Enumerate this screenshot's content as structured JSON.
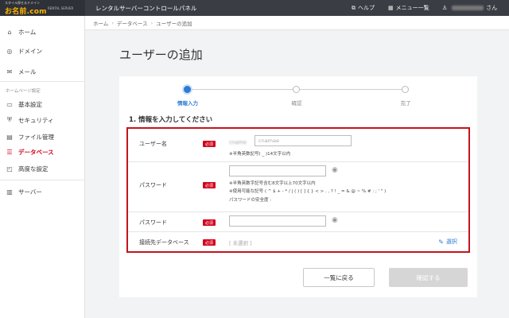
{
  "header": {
    "logo_tagline": "スタイル探せるドメイン",
    "logo_text": "お名前.com",
    "logo_sub": "RENTAL SERVER",
    "panel_title": "レンタルサーバーコントロールパネル",
    "help_label": "ヘルプ",
    "menu_label": "メニュー一覧",
    "user_suffix": "さん"
  },
  "sidebar": {
    "items_top": [
      {
        "label": "ホーム",
        "icon": "home-icon"
      },
      {
        "label": "ドメイン",
        "icon": "globe-icon"
      },
      {
        "label": "メール",
        "icon": "mail-icon"
      }
    ],
    "section_label": "ホームページ設定",
    "items_site": [
      {
        "label": "基本設定",
        "icon": "monitor-icon"
      },
      {
        "label": "セキュリティ",
        "icon": "shield-icon"
      },
      {
        "label": "ファイル管理",
        "icon": "folder-icon"
      },
      {
        "label": "データベース",
        "icon": "database-icon",
        "active": true
      },
      {
        "label": "高度な設定",
        "icon": "settings-window-icon"
      }
    ],
    "items_bottom": [
      {
        "label": "サーバー",
        "icon": "server-icon"
      }
    ],
    "active_color": "#d0021b"
  },
  "breadcrumb": [
    "ホーム",
    "データベース",
    "ユーザーの追加"
  ],
  "page_title": "ユーザーの追加",
  "steps": [
    {
      "label": "情報入力",
      "active": true
    },
    {
      "label": "確認",
      "active": false
    },
    {
      "label": "完了",
      "active": false
    }
  ],
  "section_title": "1. 情報を入力してください",
  "required_badge": "必須",
  "form": {
    "username": {
      "label": "ユーザー名",
      "prefix": "cname",
      "placeholder": "cnamae",
      "note": "※半角英数記号( _ )14文字以内"
    },
    "password": {
      "label": "パスワード",
      "value": "",
      "notes": [
        "※半角英数字記号含む8文字以上70文字以内",
        "※使用可能な記号 ( ^ $ + - * / | ( ) [ ] { } < > . , ? ! _ = & @ ~ % # : ; ' \" )",
        "パスワードの安全度 :"
      ]
    },
    "password_confirm": {
      "label": "パスワード",
      "value": ""
    },
    "database": {
      "label": "接続先データベース",
      "value": "[ 未選択 ]",
      "select_label": "選択"
    }
  },
  "buttons": {
    "back": "一覧に戻る",
    "confirm": "確認する"
  },
  "colors": {
    "accent": "#2b7bd6",
    "highlight_border": "#c4141b",
    "required": "#d0021b",
    "topbar": "#3a3d44"
  }
}
